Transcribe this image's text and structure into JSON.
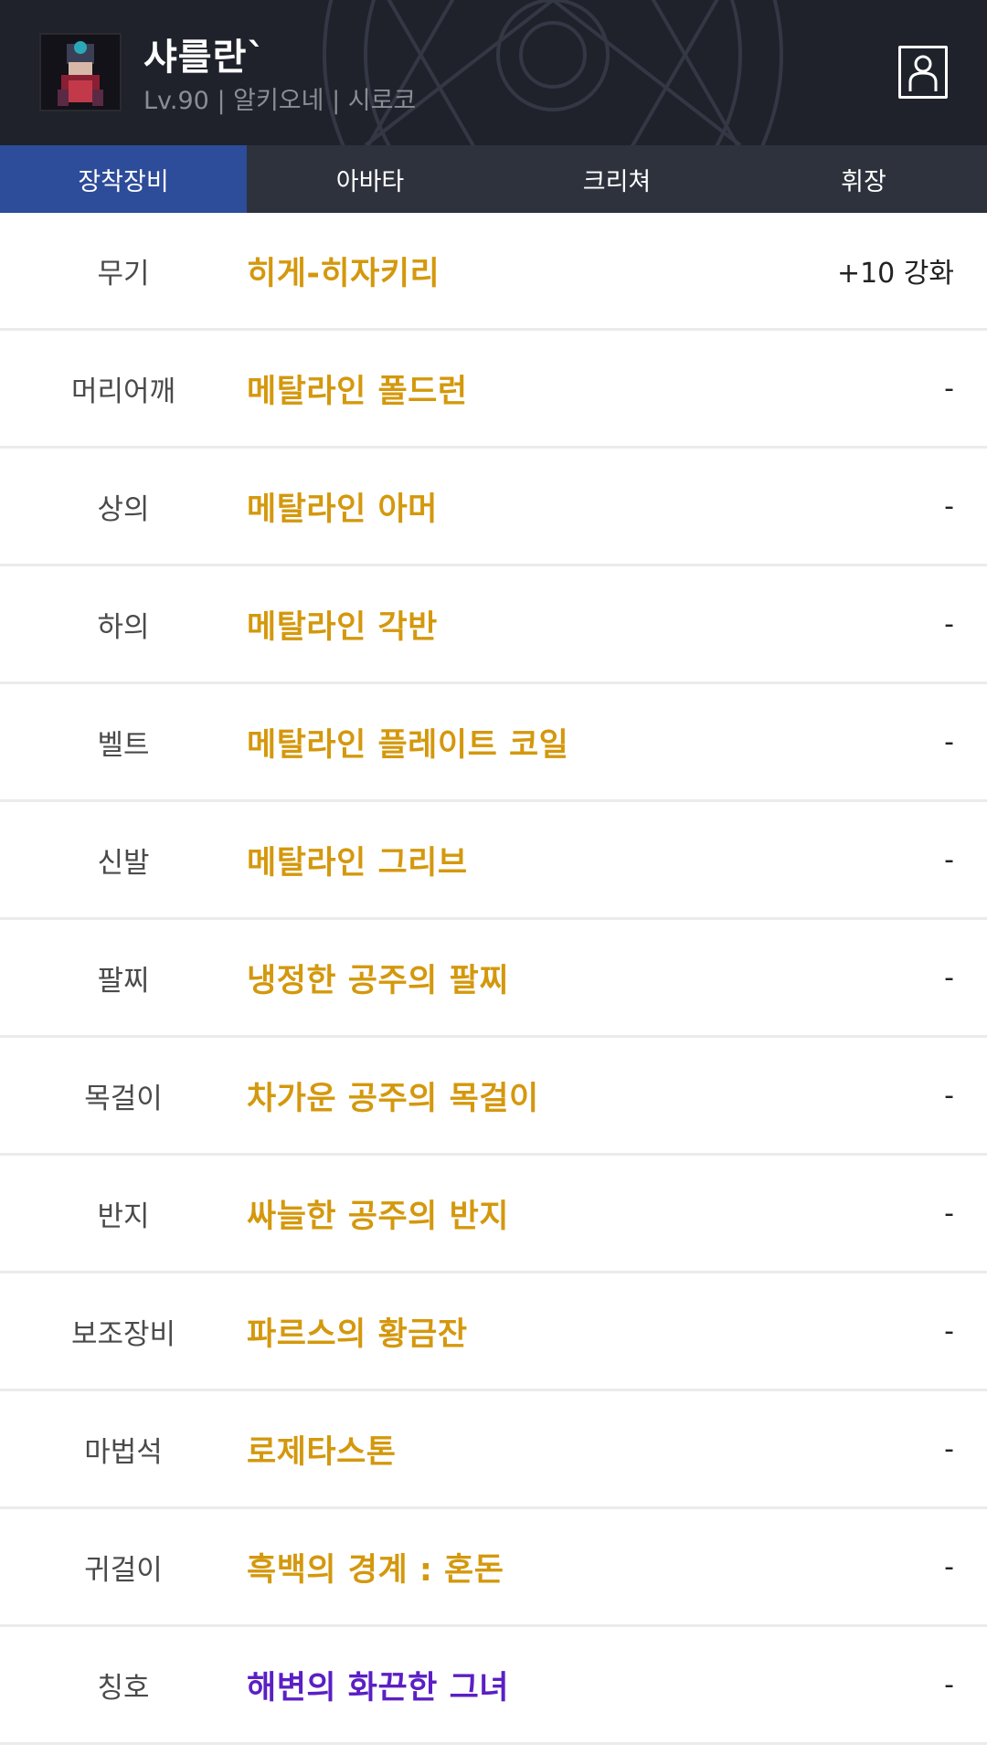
{
  "character": {
    "name": "샤를란`",
    "info": "Lv.90 | 알키오네 | 시로코"
  },
  "icons": {
    "avatar": "character-portrait",
    "profile": "user-profile-icon"
  },
  "colors": {
    "header_bg": "#1f222b",
    "tab_bar": "#2e323d",
    "tab_active": "#2d4c99",
    "item_unique": "#d4980d",
    "item_title": "#5b1fc4"
  },
  "tabs": [
    {
      "label": "장착장비",
      "active": true
    },
    {
      "label": "아바타",
      "active": false
    },
    {
      "label": "크리쳐",
      "active": false
    },
    {
      "label": "휘장",
      "active": false
    }
  ],
  "equipment": [
    {
      "slot": "무기",
      "item": "히게-히자키리",
      "enhance": "+10 강화"
    },
    {
      "slot": "머리어깨",
      "item": "메탈라인 폴드런",
      "enhance": "-"
    },
    {
      "slot": "상의",
      "item": "메탈라인 아머",
      "enhance": "-"
    },
    {
      "slot": "하의",
      "item": "메탈라인 각반",
      "enhance": "-"
    },
    {
      "slot": "벨트",
      "item": "메탈라인 플레이트 코일",
      "enhance": "-"
    },
    {
      "slot": "신발",
      "item": "메탈라인 그리브",
      "enhance": "-"
    },
    {
      "slot": "팔찌",
      "item": "냉정한 공주의 팔찌",
      "enhance": "-"
    },
    {
      "slot": "목걸이",
      "item": "차가운 공주의 목걸이",
      "enhance": "-"
    },
    {
      "slot": "반지",
      "item": "싸늘한 공주의 반지",
      "enhance": "-"
    },
    {
      "slot": "보조장비",
      "item": "파르스의 황금잔",
      "enhance": "-"
    },
    {
      "slot": "마법석",
      "item": "로제타스톤",
      "enhance": "-"
    },
    {
      "slot": "귀걸이",
      "item": "흑백의 경계 : 혼돈",
      "enhance": "-"
    },
    {
      "slot": "칭호",
      "item": "해변의 화끈한 그녀",
      "enhance": "-"
    }
  ]
}
